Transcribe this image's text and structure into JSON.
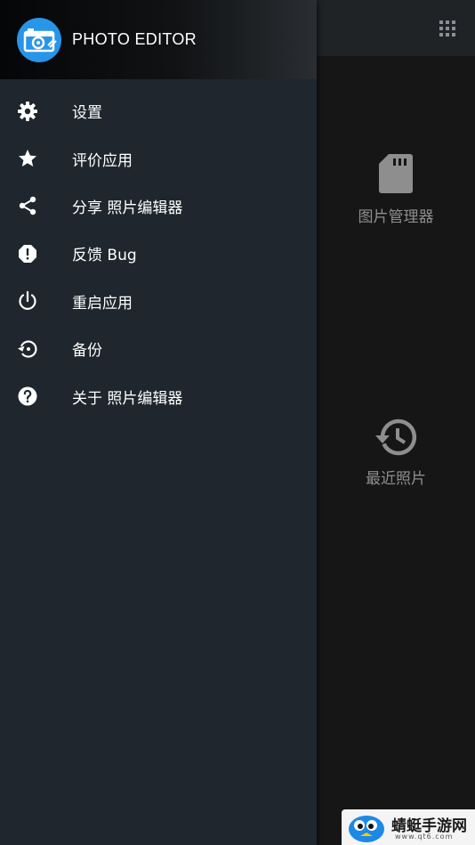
{
  "app": {
    "title": "PHOTO EDITOR"
  },
  "drawer": {
    "items": [
      {
        "icon": "gear-icon",
        "label": "设置"
      },
      {
        "icon": "star-icon",
        "label": "评价应用"
      },
      {
        "icon": "share-icon",
        "label": "分享 照片编辑器"
      },
      {
        "icon": "alert-icon",
        "label": "反馈 Bug"
      },
      {
        "icon": "power-icon",
        "label": "重启应用"
      },
      {
        "icon": "restore-icon",
        "label": "备份"
      },
      {
        "icon": "help-icon",
        "label": "关于 照片编辑器"
      }
    ]
  },
  "background": {
    "features": [
      {
        "icon": "sd-card-icon",
        "label": "图片管理器"
      },
      {
        "icon": "history-icon",
        "label": "最近照片"
      }
    ]
  },
  "watermark": {
    "text": "蜻蜓手游网",
    "url": "www.qt6.com"
  },
  "colors": {
    "drawer_bg": "#1f262d",
    "logo_blue": "#2795e8",
    "muted_text": "#8e8e8e"
  }
}
